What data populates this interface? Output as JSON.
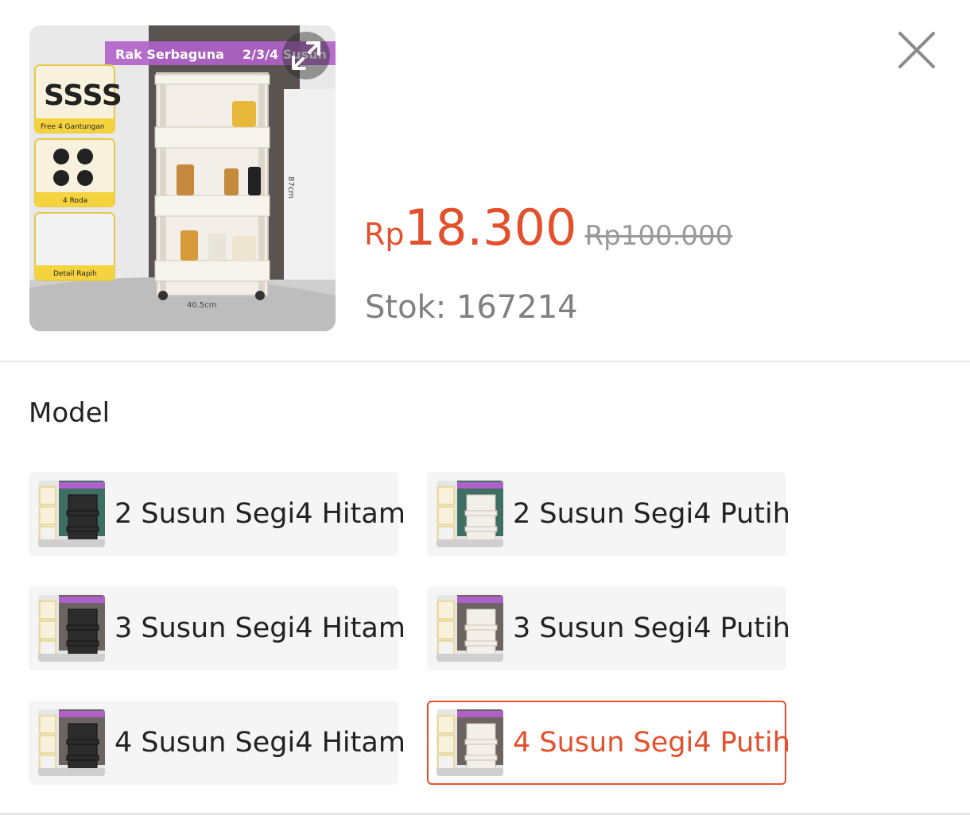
{
  "product": {
    "image_banner": "Rak Serbaguna",
    "image_badge": "2/3/4 Susun",
    "image_features": [
      "Free 4 Gantungan",
      "4 Roda",
      "Detail Rapih"
    ],
    "image_dim_height": "87cm",
    "image_dim_width": "40.5cm",
    "price_currency": "Rp",
    "price": "18.300",
    "original_price": "Rp100.000",
    "stock_text": "Stok: 167214"
  },
  "icons": {
    "expand": "expand-icon",
    "close": "close-icon"
  },
  "colors": {
    "accent": "#e4502c",
    "muted": "#9a9a9a",
    "option_bg": "#f5f5f5"
  },
  "variation": {
    "title": "Model",
    "selected_index": 5,
    "options": [
      {
        "label": "2 Susun Segi4 Hitam",
        "shelf_color": "dark"
      },
      {
        "label": "2 Susun Segi4 Putih",
        "shelf_color": "white"
      },
      {
        "label": "3 Susun Segi4 Hitam",
        "shelf_color": "dark"
      },
      {
        "label": "3 Susun Segi4 Putih",
        "shelf_color": "white"
      },
      {
        "label": "4 Susun Segi4 Hitam",
        "shelf_color": "dark"
      },
      {
        "label": "4 Susun Segi4 Putih",
        "shelf_color": "white"
      }
    ]
  }
}
